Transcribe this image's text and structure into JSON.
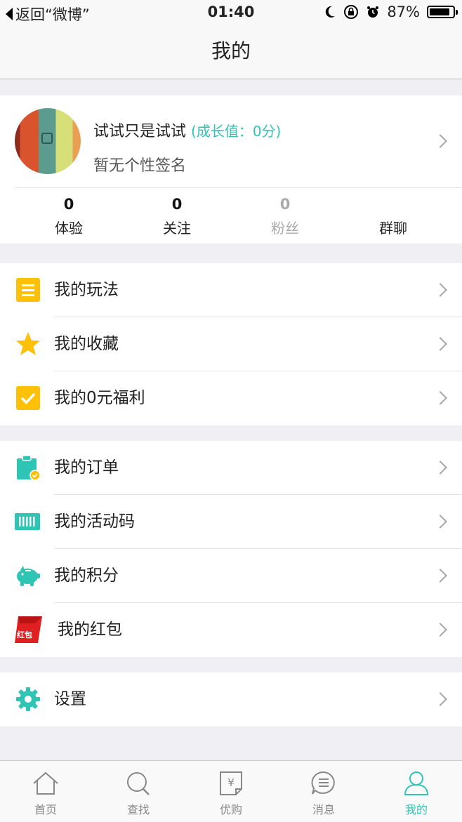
{
  "status_bar": {
    "back_label": "返回“微博”",
    "time": "01:40",
    "battery": "87%",
    "battery_level": 0.87
  },
  "nav": {
    "title": "我的"
  },
  "profile": {
    "name": "试试只是试试",
    "growth": "(成长值：0分)",
    "signature": "暂无个性签名",
    "stats": [
      {
        "count": "0",
        "label": "体验"
      },
      {
        "count": "0",
        "label": "关注"
      },
      {
        "count": "0",
        "label": "粉丝"
      },
      {
        "count": "",
        "label": "群聊"
      }
    ]
  },
  "menu": {
    "group1": [
      {
        "label": "我的玩法",
        "icon": "list-icon"
      },
      {
        "label": "我的收藏",
        "icon": "star-icon"
      },
      {
        "label": "我的0元福利",
        "icon": "checkbox-icon"
      }
    ],
    "group2": [
      {
        "label": "我的订单",
        "icon": "clipboard-icon"
      },
      {
        "label": "我的活动码",
        "icon": "barcode-icon"
      },
      {
        "label": "我的积分",
        "icon": "piggy-bank-icon"
      },
      {
        "label": "我的红包",
        "icon": "red-envelope-icon",
        "icon_text": "红包"
      }
    ],
    "group3": [
      {
        "label": "设置",
        "icon": "gear-icon"
      }
    ]
  },
  "tabbar": {
    "tabs": [
      {
        "label": "首页",
        "icon": "home-icon"
      },
      {
        "label": "查找",
        "icon": "search-icon"
      },
      {
        "label": "优购",
        "icon": "yen-bag-icon",
        "icon_text": "¥"
      },
      {
        "label": "消息",
        "icon": "message-icon"
      },
      {
        "label": "我的",
        "icon": "person-icon"
      }
    ],
    "active_index": 4
  },
  "colors": {
    "accent": "#2ec5b5",
    "yellow": "#ffc107",
    "red": "#e02020",
    "background": "#efeff4"
  }
}
